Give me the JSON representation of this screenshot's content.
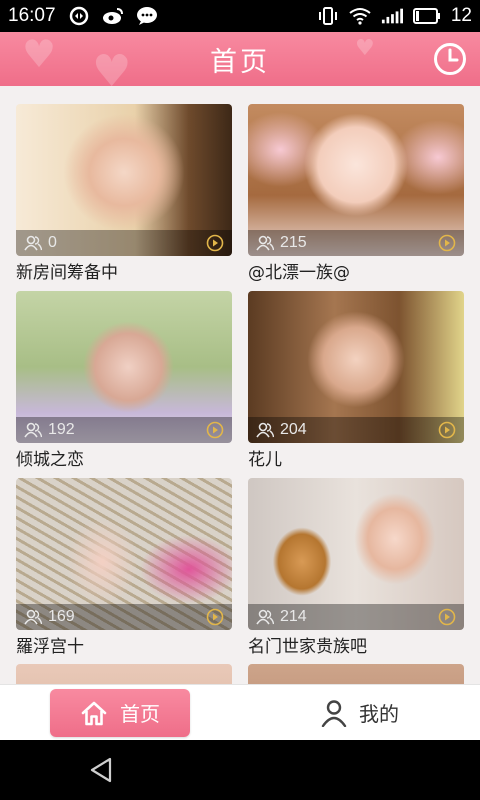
{
  "status_bar": {
    "time": "16:07",
    "left_icons": [
      "sync-icon",
      "weibo-icon",
      "chat-icon"
    ],
    "right_icons": [
      "vibrate-icon",
      "wifi-icon",
      "signal-icon",
      "battery-icon"
    ],
    "battery_level": "12"
  },
  "header": {
    "title": "首页",
    "right_icon": "history-clock-icon"
  },
  "cards": [
    {
      "count": "0",
      "title": "新房间筹备中"
    },
    {
      "count": "215",
      "title": "@北漂一族@"
    },
    {
      "count": "192",
      "title": "倾城之恋"
    },
    {
      "count": "204",
      "title": "花儿"
    },
    {
      "count": "169",
      "title": "羅浮宫十"
    },
    {
      "count": "214",
      "title": "名门世家贵族吧"
    }
  ],
  "bottom_nav": {
    "home_label": "首页",
    "me_label": "我的"
  },
  "colors": {
    "accent_pink": "#ef6e89",
    "background": "#f3f0f0"
  }
}
